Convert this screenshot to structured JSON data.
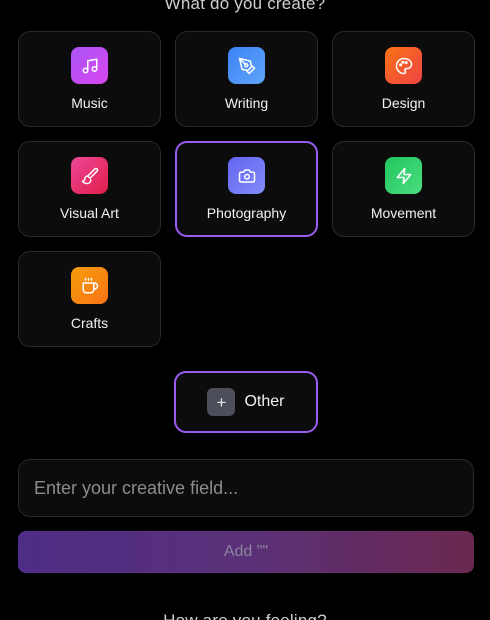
{
  "header": {
    "question": "What do you create?"
  },
  "categories": [
    {
      "label": "Music",
      "icon": "music-note-icon",
      "color_from": "#a855f7",
      "color_to": "#d946ef"
    },
    {
      "label": "Writing",
      "icon": "pen-nib-icon",
      "color_from": "#3b82f6",
      "color_to": "#60a5fa"
    },
    {
      "label": "Design",
      "icon": "palette-icon",
      "color_from": "#f97316",
      "color_to": "#ef4444"
    },
    {
      "label": "Visual Art",
      "icon": "paintbrush-icon",
      "color_from": "#ec4899",
      "color_to": "#e11d48"
    },
    {
      "label": "Photography",
      "icon": "camera-icon",
      "color_from": "#6366f1",
      "color_to": "#818cf8",
      "selected": true
    },
    {
      "label": "Movement",
      "icon": "lightning-icon",
      "color_from": "#22c55e",
      "color_to": "#4ade80"
    },
    {
      "label": "Crafts",
      "icon": "coffee-cup-icon",
      "color_from": "#f59e0b",
      "color_to": "#f97316"
    }
  ],
  "other": {
    "label": "Other",
    "icon": "plus-icon"
  },
  "input": {
    "placeholder": "Enter your creative field...",
    "value": ""
  },
  "add_button": {
    "label": "Add \"\""
  },
  "next_section": {
    "question": "How are you feeling?"
  },
  "colors": {
    "selected_border": "#9a5cf0",
    "background": "#000000"
  }
}
